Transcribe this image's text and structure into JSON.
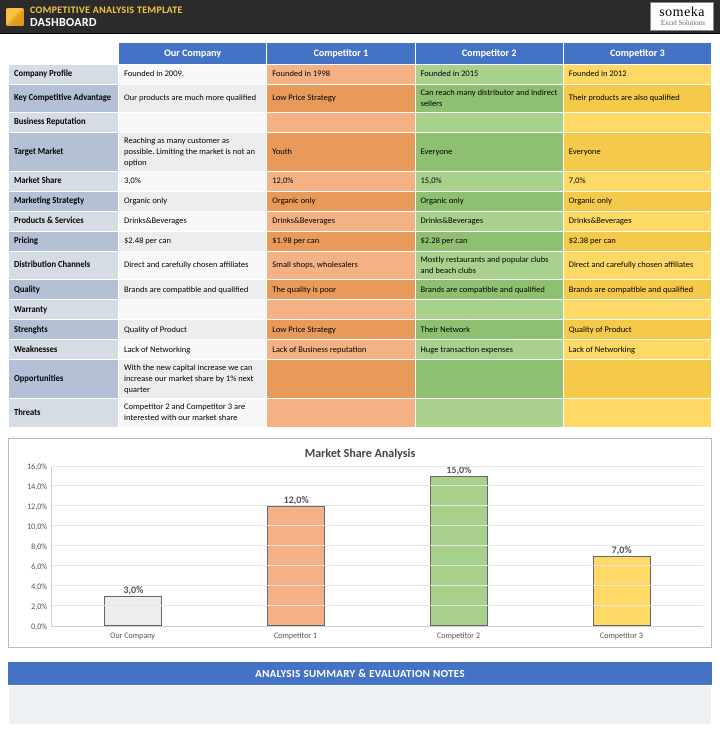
{
  "header": {
    "template_title": "COMPETITIVE ANALYSIS TEMPLATE",
    "page_title": "DASHBOARD",
    "brand_name": "someka",
    "brand_tag": "Excel Solutions"
  },
  "columns": [
    "Our Company",
    "Competitor 1",
    "Competitor 2",
    "Competitor 3"
  ],
  "colors": {
    "header_bg": "#4472c4",
    "series": [
      "#ededed",
      "#f4b183",
      "#a9d18e",
      "#ffd966"
    ]
  },
  "rows": [
    {
      "label": "Company Profile",
      "hl": false,
      "cells": [
        "Founded in 2009.",
        "Founded in 1998",
        "Founded in 2015",
        "Founded in 2012"
      ]
    },
    {
      "label": "Key Competitive Advantage",
      "hl": true,
      "cells": [
        "Our products are much more qualified",
        "Low Price Strategy",
        "Can reach many distributor and indirect sellers",
        "Their products are also qualified"
      ]
    },
    {
      "label": "Business Reputation",
      "hl": false,
      "cells": [
        "",
        "",
        "",
        ""
      ]
    },
    {
      "label": "Target Market",
      "hl": true,
      "cells": [
        "Reaching as many customer as possible. Limiting the market is not an option",
        "Youth",
        "Everyone",
        "Everyone"
      ]
    },
    {
      "label": "Market Share",
      "hl": false,
      "cells": [
        "3,0%",
        "12,0%",
        "15,0%",
        "7,0%"
      ]
    },
    {
      "label": "Marketing Strategty",
      "hl": true,
      "cells": [
        "Organic only",
        "Organic only",
        "Organic only",
        "Organic only"
      ]
    },
    {
      "label": "Products & Services",
      "hl": false,
      "cells": [
        "Drinks&Beverages",
        "Drinks&Beverages",
        "Drinks&Beverages",
        "Drinks&Beverages"
      ]
    },
    {
      "label": "Pricing",
      "hl": true,
      "cells": [
        "$2.48 per can",
        "$1.98 per can",
        "$2.28 per can",
        "$2.38 per can"
      ]
    },
    {
      "label": "Distribution Channels",
      "hl": false,
      "cells": [
        "Direct and carefully chosen affiliates",
        "Small shops, wholesalers",
        "Mostly restaurants and popular clubs and beach clubs",
        "Direct and carefully chosen affiliates"
      ]
    },
    {
      "label": "Quality",
      "hl": true,
      "cells": [
        "Brands are compatible and qualified",
        "The quality is poor",
        "Brands are compatible and qualified",
        "Brands are compatible and qualified"
      ]
    },
    {
      "label": "Warranty",
      "hl": false,
      "cells": [
        "",
        "",
        "",
        ""
      ]
    },
    {
      "label": "Strenghts",
      "hl": true,
      "cells": [
        "Quality of Product",
        "Low Price Strategy",
        "Their Network",
        "Quality of Product"
      ]
    },
    {
      "label": "Weaknesses",
      "hl": false,
      "cells": [
        "Lack of Networking",
        "Lack of  Business reputation",
        "Huge transaction expenses",
        "Lack of Networking"
      ]
    },
    {
      "label": "Opportunities",
      "hl": true,
      "cells": [
        "With the new capital increase we can increase our market share by 1% next quarter",
        "",
        "",
        ""
      ]
    },
    {
      "label": "Threats",
      "hl": false,
      "cells": [
        "Competitor 2 and Competitor 3 are interested with our market share",
        "",
        "",
        ""
      ]
    }
  ],
  "chart_data": {
    "type": "bar",
    "title": "Market Share Analysis",
    "categories": [
      "Our Company",
      "Competitor 1",
      "Competitor 2",
      "Competitor 3"
    ],
    "values": [
      3.0,
      12.0,
      15.0,
      7.0
    ],
    "value_labels": [
      "3,0%",
      "12,0%",
      "15,0%",
      "7,0%"
    ],
    "ylabel": "",
    "xlabel": "",
    "ylim": [
      0,
      16
    ],
    "yticks": [
      "0,0%",
      "2,0%",
      "4,0%",
      "6,0%",
      "8,0%",
      "10,0%",
      "12,0%",
      "14,0%",
      "16,0%"
    ]
  },
  "notes": {
    "heading": "ANALYSIS SUMMARY & EVALUATION NOTES"
  }
}
